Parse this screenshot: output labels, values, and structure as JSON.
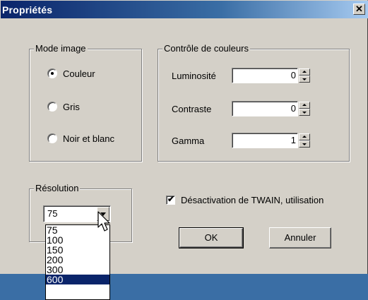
{
  "window": {
    "title": "Propriétés",
    "close_glyph": "✕"
  },
  "mode_image": {
    "legend": "Mode image",
    "options": [
      {
        "label": "Couleur",
        "checked": true
      },
      {
        "label": "Gris",
        "checked": false
      },
      {
        "label": "Noir et blanc",
        "checked": false
      }
    ]
  },
  "color_control": {
    "legend": "Contrôle de couleurs",
    "fields": [
      {
        "label": "Luminosité",
        "value": "0"
      },
      {
        "label": "Contraste",
        "value": "0"
      },
      {
        "label": "Gamma",
        "value": "1"
      }
    ]
  },
  "resolution": {
    "legend": "Résolution",
    "selected": "75",
    "options": [
      "75",
      "100",
      "150",
      "200",
      "300",
      "600"
    ],
    "highlighted": "600"
  },
  "twain_checkbox": {
    "label": "Désactivation de TWAIN, utilisation",
    "checked": true
  },
  "buttons": {
    "ok": "OK",
    "cancel": "Annuler"
  },
  "colors": {
    "face": "#d4d0c8",
    "titlebar_start": "#0a246a",
    "titlebar_end": "#a6caf0",
    "selection": "#0a246a",
    "desktop": "#3a6ea5"
  },
  "icons": {
    "close": "close-icon",
    "spin_up": "spin-up-icon",
    "spin_down": "spin-down-icon",
    "combo_arrow": "chevron-down-icon",
    "cursor": "mouse-pointer-icon"
  }
}
